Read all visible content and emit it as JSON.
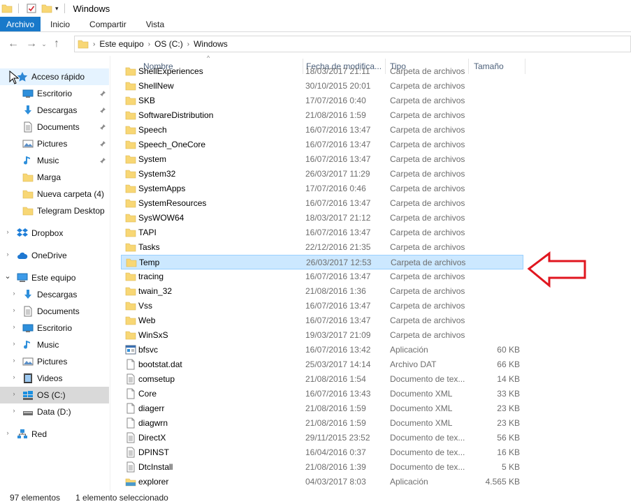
{
  "window": {
    "title": "Windows"
  },
  "ribbon": {
    "tabs": [
      "Archivo",
      "Inicio",
      "Compartir",
      "Vista"
    ]
  },
  "address": {
    "crumbs": [
      "Este equipo",
      "OS (C:)",
      "Windows"
    ]
  },
  "columns": {
    "name": "Nombre",
    "date": "Fecha de modifica...",
    "type": "Tipo",
    "size": "Tamaño"
  },
  "nav": {
    "quick_access": "Acceso rápido",
    "quick_items": [
      "Escritorio",
      "Descargas",
      "Documents",
      "Pictures",
      "Music",
      "Marga",
      "Nueva carpeta (4)",
      "Telegram Desktop"
    ],
    "dropbox": "Dropbox",
    "onedrive": "OneDrive",
    "this_pc": "Este equipo",
    "pc_items": [
      "Descargas",
      "Documents",
      "Escritorio",
      "Music",
      "Pictures",
      "Videos",
      "OS (C:)",
      "Data (D:)"
    ],
    "network": "Red"
  },
  "files": [
    {
      "name": "ShellExperiences",
      "date": "18/03/2017 21:11",
      "type": "Carpeta de archivos",
      "size": "",
      "icon": "folder-icon"
    },
    {
      "name": "ShellNew",
      "date": "30/10/2015 20:01",
      "type": "Carpeta de archivos",
      "size": "",
      "icon": "folder-icon"
    },
    {
      "name": "SKB",
      "date": "17/07/2016 0:40",
      "type": "Carpeta de archivos",
      "size": "",
      "icon": "folder-icon"
    },
    {
      "name": "SoftwareDistribution",
      "date": "21/08/2016 1:59",
      "type": "Carpeta de archivos",
      "size": "",
      "icon": "folder-icon"
    },
    {
      "name": "Speech",
      "date": "16/07/2016 13:47",
      "type": "Carpeta de archivos",
      "size": "",
      "icon": "folder-icon"
    },
    {
      "name": "Speech_OneCore",
      "date": "16/07/2016 13:47",
      "type": "Carpeta de archivos",
      "size": "",
      "icon": "folder-icon"
    },
    {
      "name": "System",
      "date": "16/07/2016 13:47",
      "type": "Carpeta de archivos",
      "size": "",
      "icon": "folder-icon"
    },
    {
      "name": "System32",
      "date": "26/03/2017 11:29",
      "type": "Carpeta de archivos",
      "size": "",
      "icon": "folder-icon"
    },
    {
      "name": "SystemApps",
      "date": "17/07/2016 0:46",
      "type": "Carpeta de archivos",
      "size": "",
      "icon": "folder-icon"
    },
    {
      "name": "SystemResources",
      "date": "16/07/2016 13:47",
      "type": "Carpeta de archivos",
      "size": "",
      "icon": "folder-icon"
    },
    {
      "name": "SysWOW64",
      "date": "18/03/2017 21:12",
      "type": "Carpeta de archivos",
      "size": "",
      "icon": "folder-icon"
    },
    {
      "name": "TAPI",
      "date": "16/07/2016 13:47",
      "type": "Carpeta de archivos",
      "size": "",
      "icon": "folder-icon"
    },
    {
      "name": "Tasks",
      "date": "22/12/2016 21:35",
      "type": "Carpeta de archivos",
      "size": "",
      "icon": "folder-icon"
    },
    {
      "name": "Temp",
      "date": "26/03/2017 12:53",
      "type": "Carpeta de archivos",
      "size": "",
      "icon": "folder-icon",
      "selected": true
    },
    {
      "name": "tracing",
      "date": "16/07/2016 13:47",
      "type": "Carpeta de archivos",
      "size": "",
      "icon": "folder-icon"
    },
    {
      "name": "twain_32",
      "date": "21/08/2016 1:36",
      "type": "Carpeta de archivos",
      "size": "",
      "icon": "folder-icon"
    },
    {
      "name": "Vss",
      "date": "16/07/2016 13:47",
      "type": "Carpeta de archivos",
      "size": "",
      "icon": "folder-icon"
    },
    {
      "name": "Web",
      "date": "16/07/2016 13:47",
      "type": "Carpeta de archivos",
      "size": "",
      "icon": "folder-icon"
    },
    {
      "name": "WinSxS",
      "date": "19/03/2017 21:09",
      "type": "Carpeta de archivos",
      "size": "",
      "icon": "folder-icon"
    },
    {
      "name": "bfsvc",
      "date": "16/07/2016 13:42",
      "type": "Aplicación",
      "size": "60 KB",
      "icon": "application-icon"
    },
    {
      "name": "bootstat.dat",
      "date": "25/03/2017 14:14",
      "type": "Archivo DAT",
      "size": "66 KB",
      "icon": "blank-file-icon"
    },
    {
      "name": "comsetup",
      "date": "21/08/2016 1:54",
      "type": "Documento de tex...",
      "size": "14 KB",
      "icon": "text-file-icon"
    },
    {
      "name": "Core",
      "date": "16/07/2016 13:43",
      "type": "Documento XML",
      "size": "33 KB",
      "icon": "blank-file-icon"
    },
    {
      "name": "diagerr",
      "date": "21/08/2016 1:59",
      "type": "Documento XML",
      "size": "23 KB",
      "icon": "blank-file-icon"
    },
    {
      "name": "diagwrn",
      "date": "21/08/2016 1:59",
      "type": "Documento XML",
      "size": "23 KB",
      "icon": "blank-file-icon"
    },
    {
      "name": "DirectX",
      "date": "29/11/2015 23:52",
      "type": "Documento de tex...",
      "size": "56 KB",
      "icon": "text-file-icon"
    },
    {
      "name": "DPINST",
      "date": "16/04/2016 0:37",
      "type": "Documento de tex...",
      "size": "16 KB",
      "icon": "text-file-icon"
    },
    {
      "name": "DtcInstall",
      "date": "21/08/2016 1:39",
      "type": "Documento de tex...",
      "size": "5 KB",
      "icon": "text-file-icon"
    },
    {
      "name": "explorer",
      "date": "04/03/2017 8:03",
      "type": "Aplicación",
      "size": "4.565 KB",
      "icon": "explorer-app-icon"
    }
  ],
  "status": {
    "count": "97 elementos",
    "selected": "1 elemento seleccionado"
  },
  "colors": {
    "file_tab": "#1979ca",
    "selection_bg": "#cce8ff",
    "selection_border": "#99d1ff",
    "folder": "#f8d775",
    "annotation": "#e0161f"
  }
}
